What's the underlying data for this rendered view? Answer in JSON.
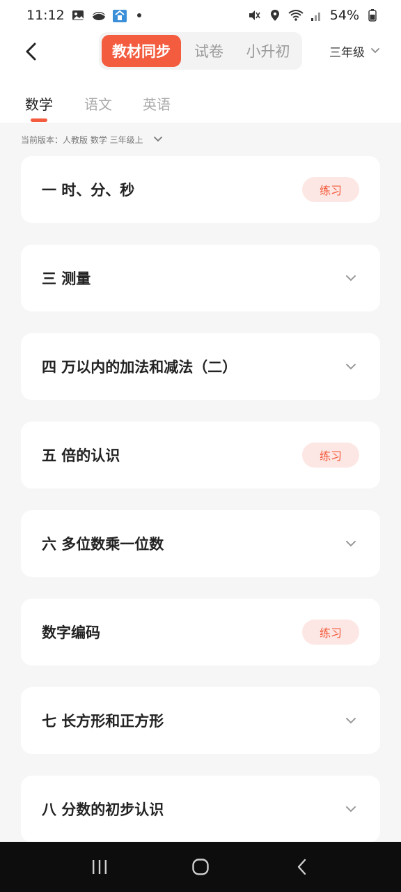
{
  "status": {
    "time": "11:12",
    "battery": "54%"
  },
  "header": {
    "segments": [
      "教材同步",
      "试卷",
      "小升初"
    ],
    "grade": "三年级"
  },
  "subjects": [
    "数学",
    "语文",
    "英语"
  ],
  "version": "当前版本：人教版 数学 三年级上",
  "practice_label": "练习",
  "chapters": [
    {
      "title": "一 时、分、秒",
      "action": "practice"
    },
    {
      "title": "三 测量",
      "action": "expand"
    },
    {
      "title": "四 万以内的加法和减法（二）",
      "action": "expand"
    },
    {
      "title": "五 倍的认识",
      "action": "practice"
    },
    {
      "title": "六 多位数乘一位数",
      "action": "expand"
    },
    {
      "title": "数字编码",
      "action": "practice"
    },
    {
      "title": "七 长方形和正方形",
      "action": "expand"
    },
    {
      "title": "八 分数的初步认识",
      "action": "expand"
    }
  ],
  "colors": {
    "accent": "#f35c3e",
    "accent_light": "#fde7e4",
    "background": "#f6f6f6"
  }
}
